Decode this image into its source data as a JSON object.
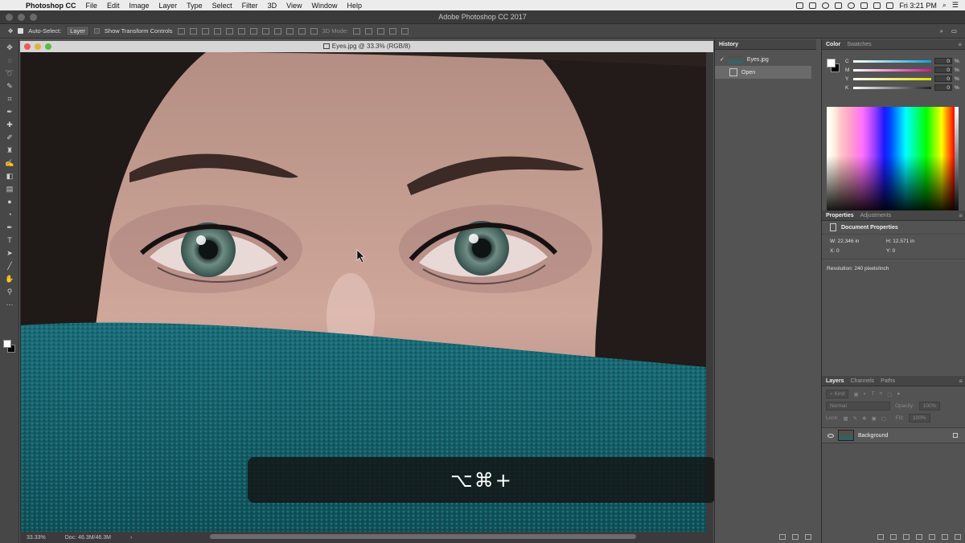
{
  "menubar": {
    "app": "Photoshop CC",
    "items": [
      "File",
      "Edit",
      "Image",
      "Layer",
      "Type",
      "Select",
      "Filter",
      "3D",
      "View",
      "Window",
      "Help"
    ],
    "clock": "Fri 3:21 PM"
  },
  "window": {
    "title": "Adobe Photoshop CC 2017"
  },
  "options": {
    "auto_select_label": "Auto-Select:",
    "auto_select_value": "Layer",
    "transform_label": "Show Transform Controls",
    "mode3d_label": "3D Mode:"
  },
  "document": {
    "title": "Eyes.jpg @ 33.3% (RGB/8)",
    "zoom": "33.33%",
    "doc_size": "Doc: 46.3M/46.3M"
  },
  "overlay": {
    "shortcut": "⌥⌘+"
  },
  "history": {
    "tab": "History",
    "snapshot": "Eyes.jpg",
    "states": [
      "Open"
    ]
  },
  "color": {
    "tabs": [
      "Color",
      "Swatches"
    ],
    "channels": [
      {
        "label": "C",
        "value": "0",
        "color": "#0aa3d4"
      },
      {
        "label": "M",
        "value": "0",
        "color": "#d4148f"
      },
      {
        "label": "Y",
        "value": "0",
        "color": "#e3de00"
      },
      {
        "label": "K",
        "value": "0",
        "color": "#202020"
      }
    ],
    "unit": "%"
  },
  "properties": {
    "tabs": [
      "Properties",
      "Adjustments"
    ],
    "heading": "Document Properties",
    "w": "W: 22.346 in",
    "h": "H: 12.571 in",
    "x": "X: 0",
    "y": "Y: 0",
    "resolution": "Resolution: 240 pixels/inch"
  },
  "layers": {
    "tabs": [
      "Layers",
      "Channels",
      "Paths"
    ],
    "kind": "Kind",
    "blend": "Normal",
    "opacity_label": "Opacity:",
    "opacity_value": "100%",
    "lock_label": "Lock:",
    "fill_label": "Fill:",
    "fill_value": "100%",
    "items": [
      {
        "name": "Background"
      }
    ]
  }
}
